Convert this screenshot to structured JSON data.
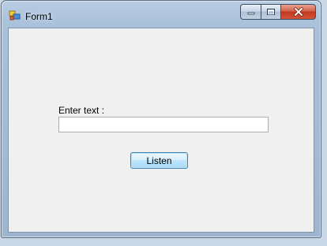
{
  "window": {
    "title": "Form1",
    "app_icon": "winforms-app-icon",
    "caption_buttons": {
      "minimize_icon": "minimize-icon",
      "maximize_icon": "maximize-icon",
      "close_icon": "close-icon"
    }
  },
  "form": {
    "label_text": "Enter text :",
    "textbox_value": "",
    "textbox_placeholder": "",
    "button_label": "Listen"
  },
  "colors": {
    "client_background": "#f0f0f0",
    "close_button": "#c0391d",
    "button_border": "#3c7fb1"
  }
}
